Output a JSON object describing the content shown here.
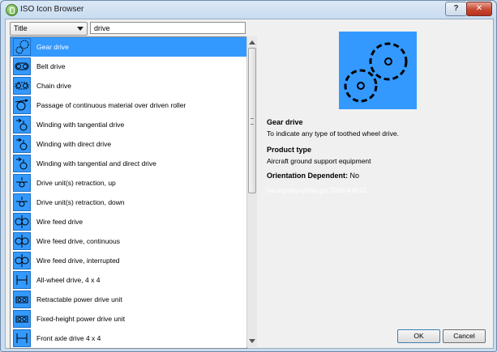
{
  "window": {
    "title": "ISO Icon Browser",
    "help_label": "?",
    "close_label": "✕"
  },
  "search": {
    "field_selected": "Title",
    "query": "drive"
  },
  "list": {
    "items": [
      {
        "label": "Gear drive",
        "icon": "gear-drive-icon",
        "selected": true
      },
      {
        "label": "Belt drive",
        "icon": "belt-drive-icon"
      },
      {
        "label": "Chain drive",
        "icon": "chain-drive-icon"
      },
      {
        "label": "Passage of continuous material over driven roller",
        "icon": "roller-icon"
      },
      {
        "label": "Winding with tangential drive",
        "icon": "winding-icon"
      },
      {
        "label": "Winding with direct drive",
        "icon": "winding-icon"
      },
      {
        "label": "Winding with tangential and direct drive",
        "icon": "winding-icon"
      },
      {
        "label": "Drive unit(s) retraction, up",
        "icon": "retraction-up-icon"
      },
      {
        "label": "Drive unit(s) retraction, down",
        "icon": "retraction-down-icon"
      },
      {
        "label": "Wire feed drive",
        "icon": "wire-feed-icon"
      },
      {
        "label": "Wire feed drive, continuous",
        "icon": "wire-feed-icon"
      },
      {
        "label": "Wire feed drive, interrupted",
        "icon": "wire-feed-icon"
      },
      {
        "label": "All-wheel drive, 4 x 4",
        "icon": "axle-icon"
      },
      {
        "label": "Retractable power drive unit",
        "icon": "power-unit-icon"
      },
      {
        "label": "Fixed-height power drive unit",
        "icon": "power-unit-icon"
      },
      {
        "label": "Front axle drive 4 x 4",
        "icon": "axle-icon"
      }
    ]
  },
  "detail": {
    "name": "Gear drive",
    "description": "To indicate any type of toothed wheel drive.",
    "product_type_label": "Product type",
    "product_type": "Aircraft ground support equipment",
    "orientation_label": "Orientation Dependent:",
    "orientation_value": "No",
    "iso_ref": "iso.org/obp/ui#iso:grs:7000:4:0012"
  },
  "buttons": {
    "ok": "OK",
    "cancel": "Cancel"
  },
  "colors": {
    "selection": "#3399ff",
    "icon_bg": "#3399ff"
  }
}
